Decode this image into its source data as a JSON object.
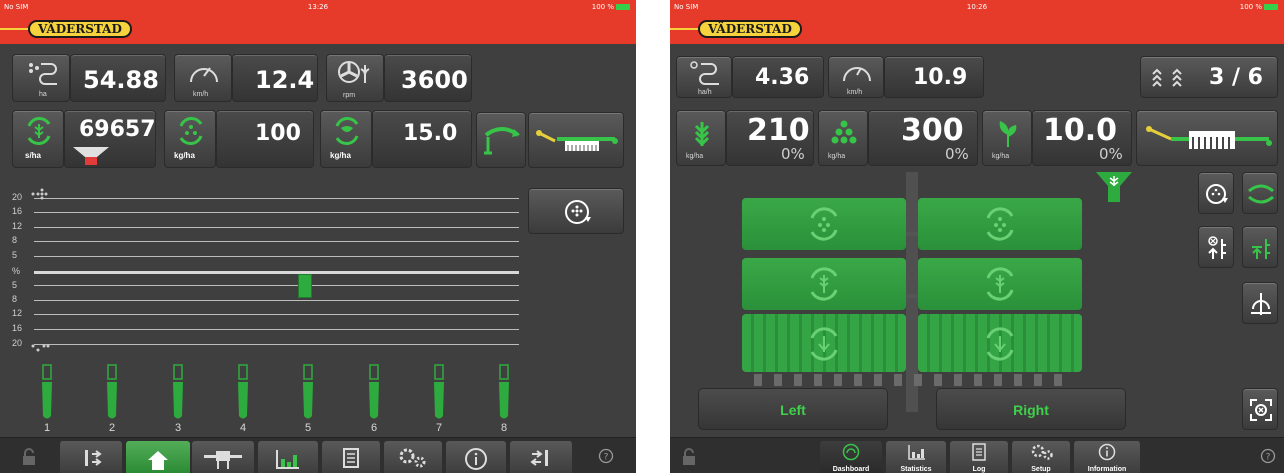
{
  "left_screen": {
    "status": {
      "carrier": "No SIM",
      "time": "13:26",
      "battery": "100 %"
    },
    "brand": "VÄDERSTAD",
    "rate_tiles": [
      {
        "value": "54.88",
        "unit": "ha",
        "icon": "area-counter-icon"
      },
      {
        "value": "12.4",
        "unit": "km/h",
        "icon": "speedometer-icon"
      },
      {
        "value": "3600",
        "unit": "rpm",
        "icon": "fan-rpm-icon"
      }
    ],
    "metering_tiles": [
      {
        "value": "69657",
        "unit": "s/ha",
        "icon": "seed-meter-icon"
      },
      {
        "value": "100",
        "unit": "kg/ha",
        "icon": "fertilizer-meter-icon"
      },
      {
        "value": "15.0",
        "unit": "kg/ha",
        "icon": "microgranule-meter-icon"
      }
    ],
    "gauge_ticks": [
      "20",
      "16",
      "12",
      "8",
      "5",
      "%",
      "5",
      "8",
      "12",
      "16",
      "20"
    ],
    "gauge_marker_row": 5,
    "row_units": [
      "1",
      "2",
      "3",
      "4",
      "5",
      "6",
      "7",
      "8"
    ],
    "accent": "#2eab3f"
  },
  "right_screen": {
    "status": {
      "carrier": "No SIM",
      "time": "10:26",
      "battery": "100 %"
    },
    "brand": "VÄDERSTAD",
    "tiles": [
      {
        "value": "4.36",
        "unit": "ha/h",
        "icon": "area-rate-icon"
      },
      {
        "value": "10.9",
        "unit": "km/h",
        "icon": "speedometer-icon"
      },
      {
        "value": "3 / 6",
        "unit": "",
        "icon": "tramline-icon"
      }
    ],
    "rate_tiles": [
      {
        "value": "210",
        "unit": "kg/ha",
        "percent": "0%",
        "icon": "seed-icon"
      },
      {
        "value": "300",
        "unit": "kg/ha",
        "percent": "0%",
        "icon": "fertilizer-icon"
      },
      {
        "value": "10.0",
        "unit": "kg/ha",
        "percent": "0%",
        "icon": "plant-icon"
      }
    ],
    "sections": {
      "left": "Left",
      "right": "Right"
    },
    "nav": [
      "Dashboard",
      "Statistics",
      "Log",
      "Setup",
      "Information"
    ],
    "help": "?"
  }
}
